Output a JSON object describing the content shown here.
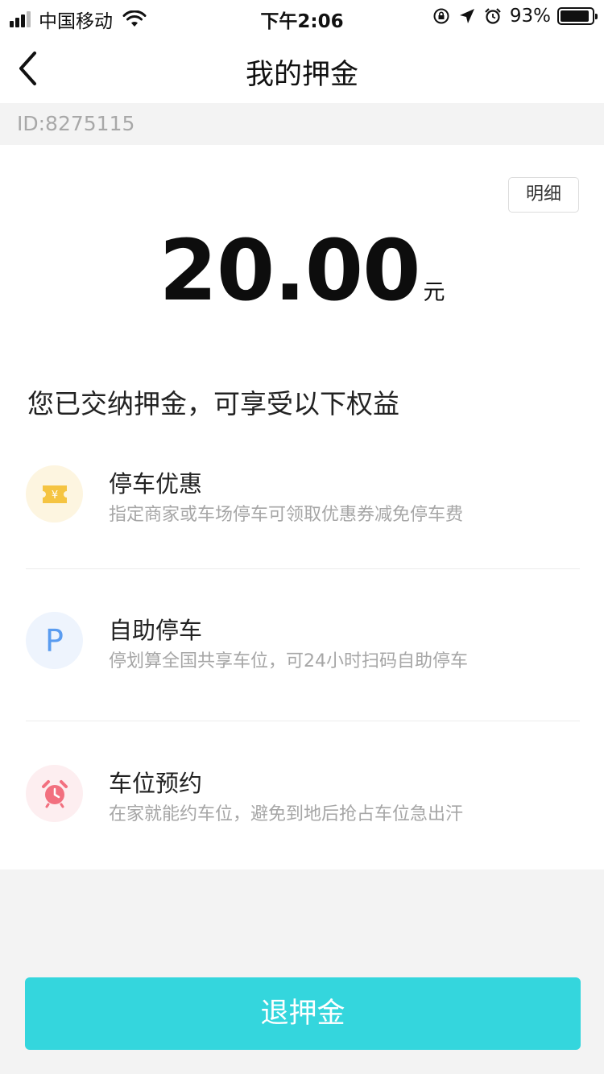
{
  "status_bar": {
    "carrier": "中国移动",
    "time": "下午2:06",
    "battery_percent": "93%",
    "battery_level": 0.93
  },
  "nav": {
    "title": "我的押金"
  },
  "account": {
    "id_text": "ID:8275115"
  },
  "deposit": {
    "detail_label": "明细",
    "amount": "20.00",
    "unit": "元"
  },
  "benefits": {
    "heading": "您已交纳押金，可享受以下权益",
    "items": [
      {
        "title": "停车优惠",
        "desc": "指定商家或车场停车可领取优惠券减免停车费",
        "icon": "coupon-icon",
        "color": "#f5c442"
      },
      {
        "title": "自助停车",
        "desc": "停划算全国共享车位，可24小时扫码自助停车",
        "icon": "parking-icon",
        "color": "#5a9cf0"
      },
      {
        "title": "车位预约",
        "desc": "在家就能约车位，避免到地后抢占车位急出汗",
        "icon": "alarm-clock-icon",
        "color": "#f2707f"
      }
    ]
  },
  "footer": {
    "refund_label": "退押金"
  },
  "colors": {
    "accent": "#34d6dd",
    "background": "#f3f3f3"
  }
}
